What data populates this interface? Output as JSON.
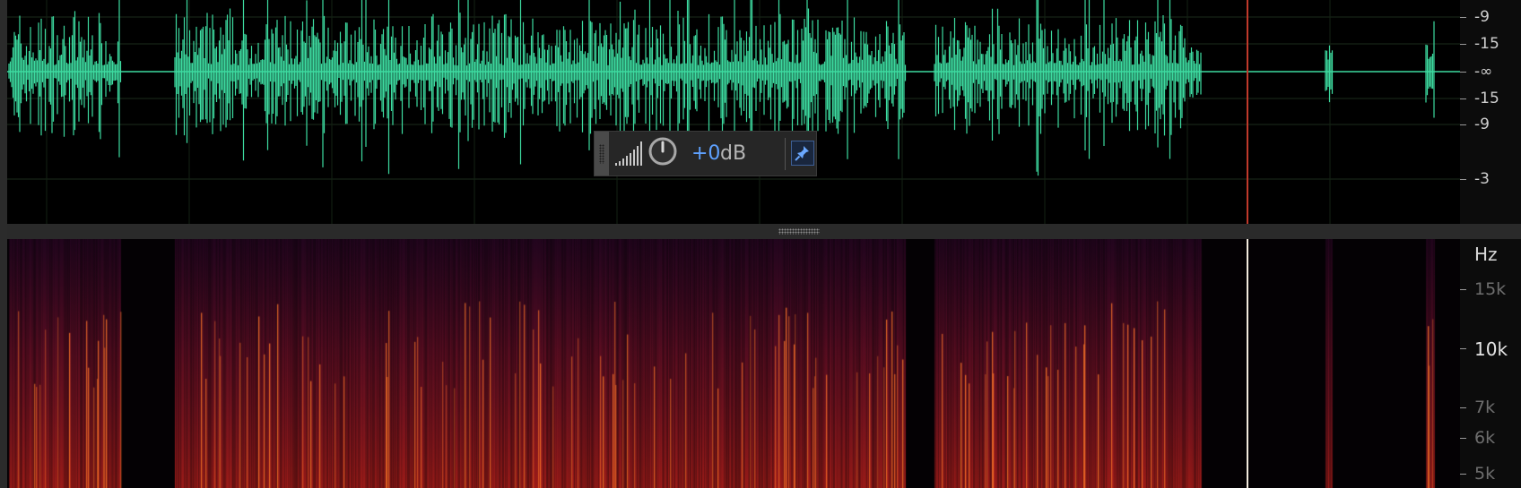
{
  "app": {
    "name": "audio editor",
    "waveform_color": "#3ddba0",
    "playhead_color": "#c0392b"
  },
  "waveform": {
    "db_scale": [
      {
        "label": "-9"
      },
      {
        "label": "-15"
      },
      {
        "label": "-∞"
      },
      {
        "label": "-15"
      },
      {
        "label": "-9"
      },
      {
        "label": "-3"
      }
    ]
  },
  "gain_hud": {
    "value": "+0",
    "unit": "dB",
    "meter_icon": "level-meter-icon",
    "knob_icon": "gain-knob-icon",
    "pin_icon": "pin-icon",
    "accent": "#5ea1ff"
  },
  "spectrogram": {
    "unit_label": "Hz",
    "freq_scale": [
      {
        "label": "15k"
      },
      {
        "label": "10k"
      },
      {
        "label": "7k"
      },
      {
        "label": "6k"
      },
      {
        "label": "5k"
      }
    ]
  }
}
